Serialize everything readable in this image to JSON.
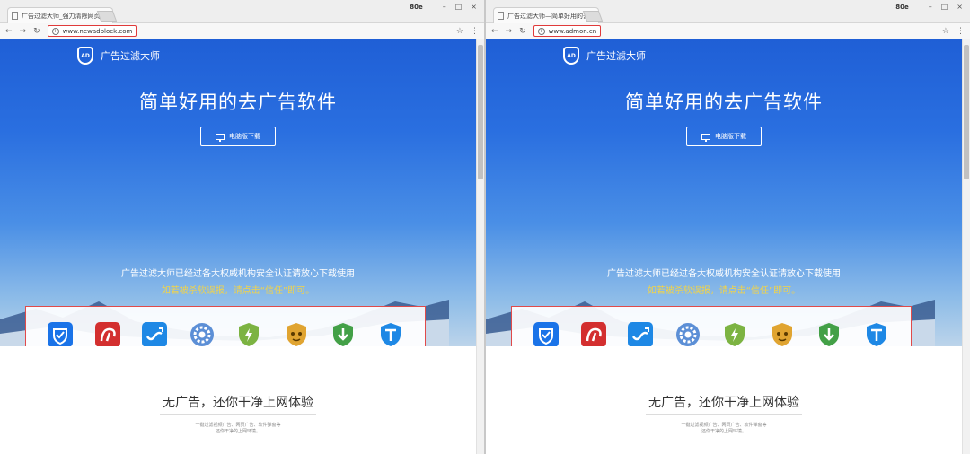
{
  "windows": [
    {
      "tab_title": "广告过滤大师_强力清除网页广告",
      "user_label": "80e",
      "url": "www.newadblock.com",
      "logo_text": "广告过滤大师",
      "hero_title": "简单好用的去广告软件",
      "download_label": "电脑版下载",
      "certification_text": "广告过滤大师已经过各大权威机构安全认证请放心下载使用",
      "trust_text": "如若被杀软误报，请点击“信任”即可。",
      "slogan": "无广告，还你干净上网体验",
      "small_text_1": "一键过滤视频广告、网页广告、软件弹窗等",
      "small_text_2": "还你干净的上网环境。"
    },
    {
      "tab_title": "广告过滤大师—简单好用的去广告软件",
      "user_label": "80e",
      "url": "www.admon.cn",
      "logo_text": "广告过滤大师",
      "hero_title": "简单好用的去广告软件",
      "download_label": "电脑版下载",
      "certification_text": "广告过滤大师已经过各大权威机构安全认证请放心下载使用",
      "trust_text": "如若被杀软误报，请点击“信任”即可。",
      "slogan": "无广告，还你干净上网体验",
      "small_text_1": "一键过滤视频广告、网页广告、软件弹窗等",
      "small_text_2": "还你干净的上网环境。"
    }
  ],
  "icons": {
    "close": "×",
    "minimize": "–",
    "maximize": "□",
    "back": "←",
    "forward": "→",
    "reload": "↻",
    "star": "☆",
    "menu": "⋮"
  },
  "badges": [
    {
      "name": "tencent-security-icon",
      "color": "#1a73e8"
    },
    {
      "name": "avira-icon",
      "color": "#d32f2f"
    },
    {
      "name": "jinshan-icon",
      "color": "#1e88e5"
    },
    {
      "name": "gear-shield-icon",
      "color": "#5c8fd6"
    },
    {
      "name": "360-icon",
      "color": "#7cb342"
    },
    {
      "name": "rising-icon",
      "color": "#e0a431"
    },
    {
      "name": "download-shield-icon",
      "color": "#43a047"
    },
    {
      "name": "t-shield-icon",
      "color": "#1e88e5"
    }
  ]
}
